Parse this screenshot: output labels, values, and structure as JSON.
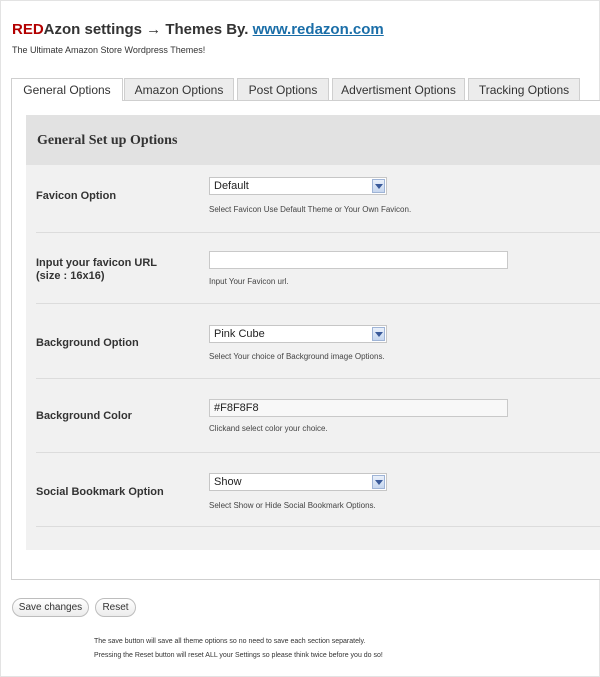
{
  "header": {
    "brand_red": "RED",
    "brand_rest": "Azon settings → Themes By.",
    "link": "www.redazon.com",
    "subtitle": "The Ultimate Amazon Store Wordpress Themes!"
  },
  "tabs": [
    {
      "label": "General Options",
      "active": true
    },
    {
      "label": "Amazon Options",
      "active": false
    },
    {
      "label": "Post Options",
      "active": false
    },
    {
      "label": "Advertisment Options",
      "active": false
    },
    {
      "label": "Tracking Options",
      "active": false
    }
  ],
  "section": {
    "heading": "General Set up Options"
  },
  "fields": {
    "favicon": {
      "label": "Favicon Option",
      "value": "Default",
      "hint": "Select Favicon Use Default Theme or Your Own Favicon."
    },
    "favicon_url": {
      "label_line1": "Input your favicon URL",
      "label_line2": "(size : 16x16)",
      "value": "",
      "hint": "Input Your Favicon url."
    },
    "background": {
      "label": "Background Option",
      "value": "Pink Cube",
      "hint": "Select Your choice of Background image Options."
    },
    "bg_color": {
      "label": "Background Color",
      "value": "#F8F8F8",
      "hint": "Clickand select color your choice."
    },
    "social": {
      "label": "Social Bookmark Option",
      "value": "Show",
      "hint": "Select Show or Hide Social Bookmark Options."
    }
  },
  "buttons": {
    "save": "Save changes",
    "reset": "Reset"
  },
  "footer": {
    "line1": "The save button will save all theme options so no need to save each section separately.",
    "line2": "Pressing the Reset button will reset ALL your Settings so please think twice before you do so!"
  },
  "colors": {
    "brand_red": "#b30000",
    "link_blue": "#1a6ea8",
    "panel_gray": "#f1f1f1"
  }
}
